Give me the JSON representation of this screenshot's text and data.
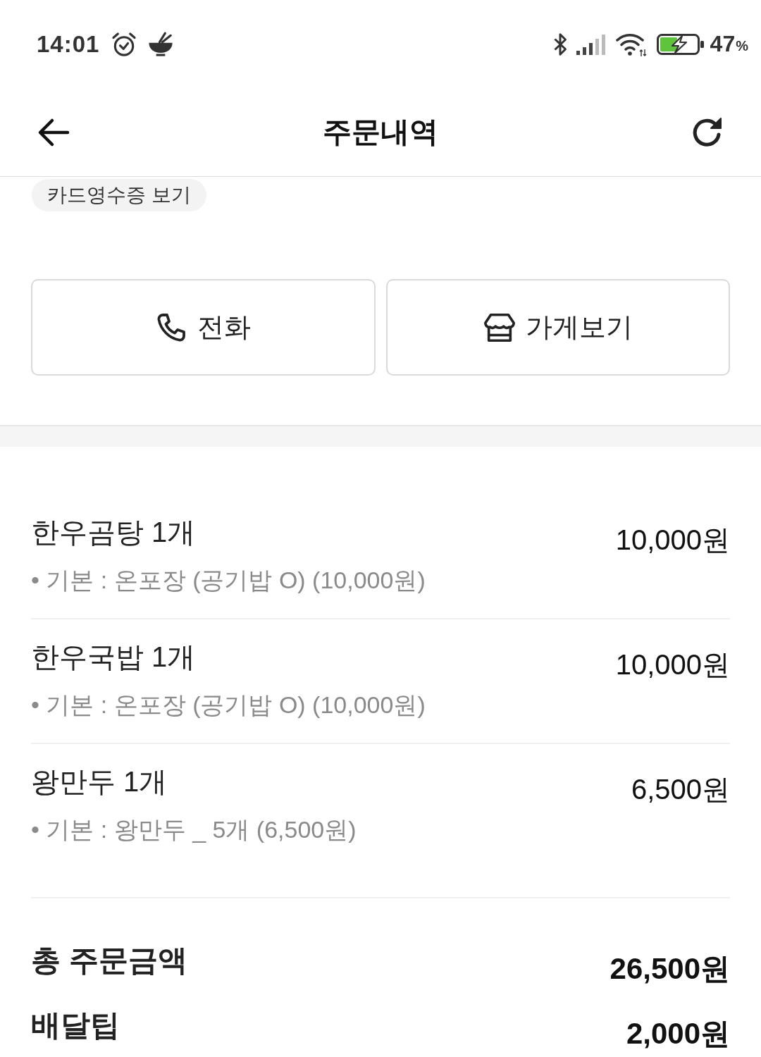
{
  "status_bar": {
    "time": "14:01",
    "battery_percent": "47",
    "battery_unit": "%"
  },
  "header": {
    "title": "주문내역"
  },
  "receipt_button": {
    "label": "카드영수증 보기"
  },
  "actions": [
    {
      "kind": "phone",
      "label": "전화"
    },
    {
      "kind": "store",
      "label": "가게보기"
    }
  ],
  "order_items": [
    {
      "name": "한우곰탕 1개",
      "price": "10,000원",
      "option": "• 기본 : 온포장 (공기밥 O) (10,000원)"
    },
    {
      "name": "한우국밥 1개",
      "price": "10,000원",
      "option": "• 기본 : 온포장 (공기밥 O) (10,000원)"
    },
    {
      "name": "왕만두 1개",
      "price": "6,500원",
      "option": "• 기본 : 왕만두 _ 5개 (6,500원)"
    }
  ],
  "totals": [
    {
      "label": "총 주문금액",
      "amount": "26,500원"
    },
    {
      "label": "배달팁",
      "amount": "2,000원"
    }
  ]
}
